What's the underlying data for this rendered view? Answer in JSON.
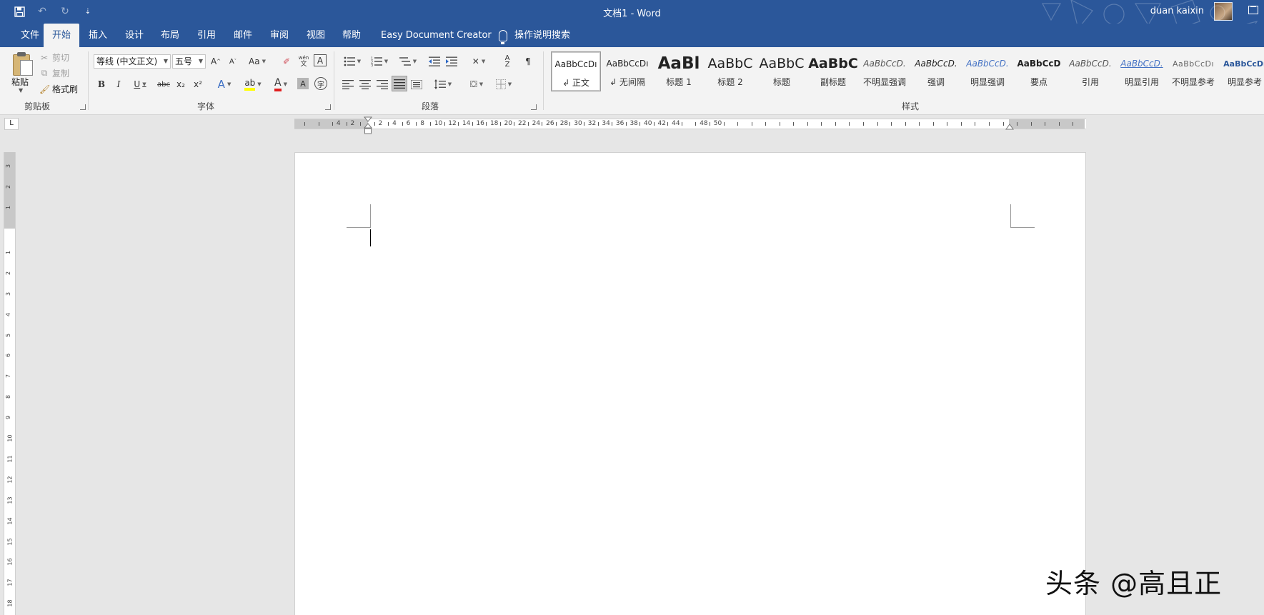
{
  "window": {
    "title": "文档1  -  Word",
    "user": "duan kaixin"
  },
  "qat": {
    "icons": [
      "save-icon",
      "undo-icon",
      "redo-icon",
      "customize-icon"
    ]
  },
  "tabs": [
    "文件",
    "开始",
    "插入",
    "设计",
    "布局",
    "引用",
    "邮件",
    "审阅",
    "视图",
    "帮助",
    "Easy Document Creator"
  ],
  "tell_me": "操作说明搜索",
  "clipboard": {
    "paste": "粘贴",
    "cut": "剪切",
    "copy": "复制",
    "format_painter": "格式刷",
    "label": "剪贴板"
  },
  "font": {
    "name": "等线 (中文正文)",
    "size": "五号",
    "label": "字体",
    "grow": "A",
    "shrink": "A",
    "case": "Aa",
    "bold": "B",
    "italic": "I",
    "underline": "U",
    "strike": "abc",
    "sub": "x₂",
    "sup": "x²",
    "phonetic": "wén",
    "char_border": "A",
    "enclose": "字",
    "color_a": "A"
  },
  "paragraph": {
    "label": "段落"
  },
  "styles": {
    "label": "样式",
    "items": [
      {
        "sample": "AaBbCcDı",
        "name": "↲ 正文"
      },
      {
        "sample": "AaBbCcDı",
        "name": "↲ 无间隔"
      },
      {
        "sample": "AaBl",
        "name": "标题 1"
      },
      {
        "sample": "AaBbC",
        "name": "标题 2"
      },
      {
        "sample": "AaBbC",
        "name": "标题"
      },
      {
        "sample": "AaBbC",
        "name": "副标题"
      },
      {
        "sample": "AaBbCcD.",
        "name": "不明显强调"
      },
      {
        "sample": "AaBbCcD.",
        "name": "强调"
      },
      {
        "sample": "AaBbCcD.",
        "name": "明显强调"
      },
      {
        "sample": "AaBbCcD",
        "name": "要点"
      },
      {
        "sample": "AaBbCcD.",
        "name": "引用"
      },
      {
        "sample": "AaBbCcD.",
        "name": "明显引用"
      },
      {
        "sample": "AaBbCcDı",
        "name": "不明显参考"
      },
      {
        "sample": "AaBbCcDı",
        "name": "明显参考"
      }
    ]
  },
  "ruler": {
    "corner": "L",
    "h_ticks": [
      "4",
      "2",
      "2",
      "4",
      "6",
      "8",
      "10",
      "12",
      "14",
      "16",
      "18",
      "20",
      "22",
      "24",
      "26",
      "28",
      "30",
      "32",
      "34",
      "36",
      "38",
      "40",
      "42",
      "44",
      "48",
      "50"
    ],
    "v_ticks": [
      "3",
      "2",
      "1",
      "1",
      "2",
      "3",
      "4",
      "5",
      "6",
      "7",
      "8",
      "9",
      "10",
      "11",
      "12",
      "13",
      "14",
      "15",
      "16",
      "17",
      "18"
    ]
  },
  "watermark": "头条 @高且正",
  "colors": {
    "accent": "#2b579a",
    "ribbon": "#f3f3f3",
    "canvas": "#e6e6e6"
  }
}
